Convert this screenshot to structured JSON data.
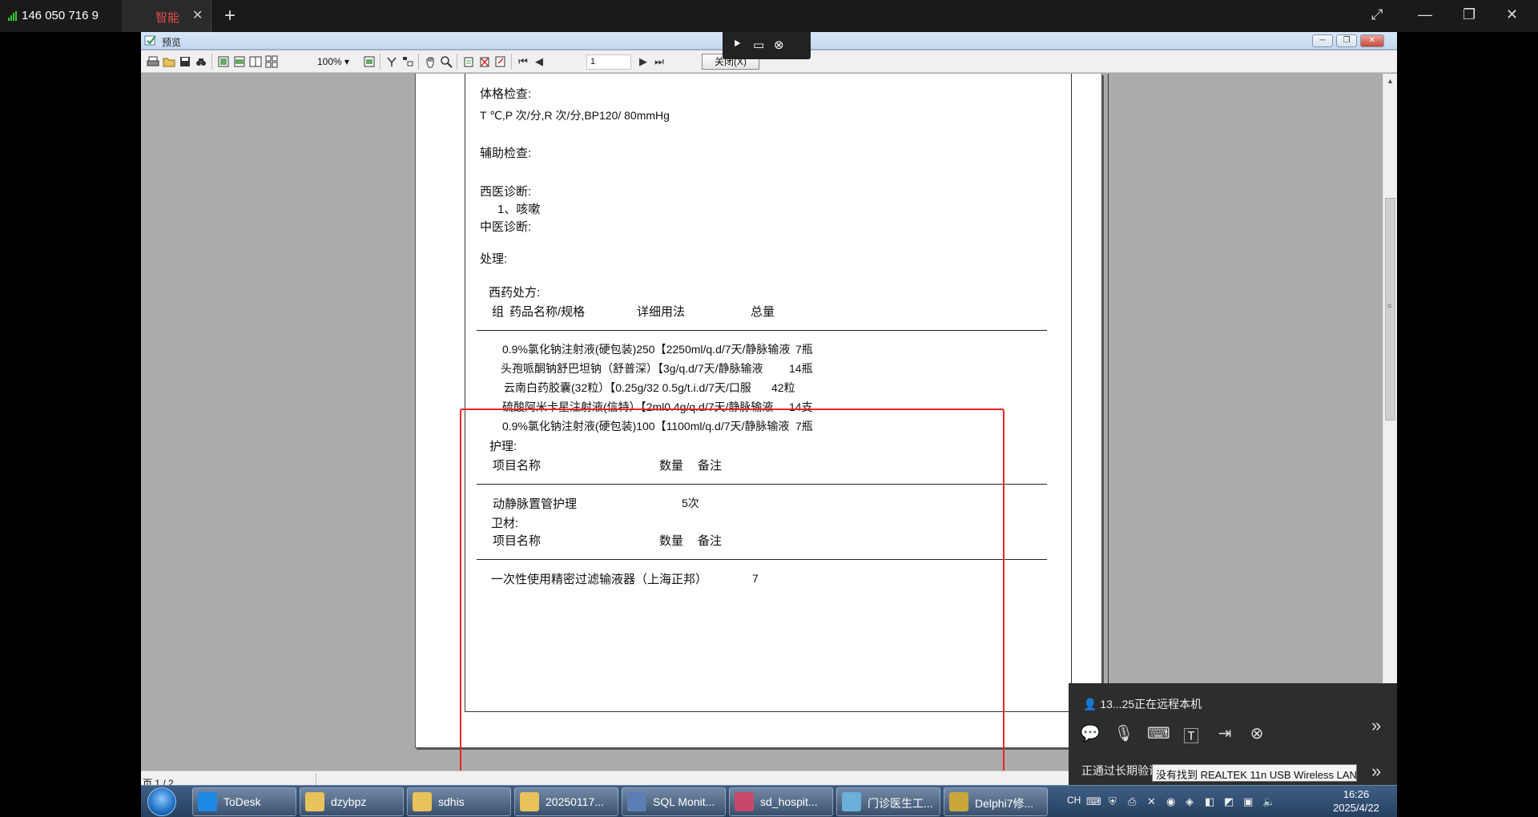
{
  "remote_client": {
    "device_id": "146 050 716 9",
    "tab_label": "智能",
    "tab_close": "✕",
    "new_tab": "+",
    "controls": {
      "fullscreen": "⤢",
      "minimize": "—",
      "restore": "❐",
      "close": "✕"
    }
  },
  "preview_window": {
    "title": "预览",
    "zoom": "100%",
    "page_number": "1",
    "close_label": "关闭(X)",
    "status_page": "页 1 / 2"
  },
  "document": {
    "physical_exam_heading": "体格检查:",
    "vitals": "T    ℃,P   次/分,R  次/分,BP120/ 80mmHg",
    "aux_exam_heading": "辅助检查:",
    "western_diagnosis_heading": "西医诊断:",
    "western_diagnosis_item": "1、咳嗽",
    "chinese_diagnosis_heading": "中医诊断:",
    "treatment_heading": "处理:",
    "prescription": {
      "heading": "西药处方:",
      "col_group": "组",
      "col_name": "药品名称/规格",
      "col_usage": "详细用法",
      "col_total": "总量",
      "rows": [
        {
          "name": "0.9%氯化钠注射液(硬包装)250【2250ml/q.d/7天/静脉输液",
          "total": "7瓶"
        },
        {
          "name": "头孢哌酮钠舒巴坦钠（舒普深）【3g/q.d/7天/静脉输液",
          "total": "14瓶"
        },
        {
          "name": "云南白药胶囊(32粒）【0.25g/32 0.5g/t.i.d/7天/口服",
          "total": "42粒"
        },
        {
          "name": "硫酸阿米卡星注射液(信特）【2ml0.4g/q.d/7天/静脉输液",
          "total": "14支"
        },
        {
          "name": "0.9%氯化钠注射液(硬包装)100【1100ml/q.d/7天/静脉输液",
          "total": "7瓶"
        }
      ]
    },
    "nursing": {
      "heading": "护理:",
      "col_name": "项目名称",
      "col_qty": "数量",
      "col_note": "备注",
      "item_name": "动静脉置管护理",
      "item_qty": "5次"
    },
    "supplies": {
      "heading": "卫材:",
      "col_name": "项目名称",
      "col_qty": "数量",
      "col_note": "备注",
      "item_name": "一次性使用精密过滤输液器（上海正邦）",
      "item_qty": "7"
    }
  },
  "remote_session": {
    "status": "13...25正在远程本机",
    "bottom_text": "正通过长期验证",
    "tooltip": "没有找到 REALTEK 11n USB Wireless LAN"
  },
  "taskbar": {
    "items": [
      {
        "label": "ToDesk",
        "color": "#1e88e5"
      },
      {
        "label": "dzybpz",
        "color": "#e8c25a"
      },
      {
        "label": "sdhis",
        "color": "#e8c25a"
      },
      {
        "label": "20250117...",
        "color": "#e8c25a"
      },
      {
        "label": "SQL Monit...",
        "color": "#5b7fb5"
      },
      {
        "label": "sd_hospit...",
        "color": "#c8486a"
      },
      {
        "label": "门诊医生工...",
        "color": "#6ab0d8"
      },
      {
        "label": "Delphi7修...",
        "color": "#c9a63a"
      }
    ],
    "ime": "CH",
    "time": "16:26",
    "date": "2025/4/22"
  }
}
